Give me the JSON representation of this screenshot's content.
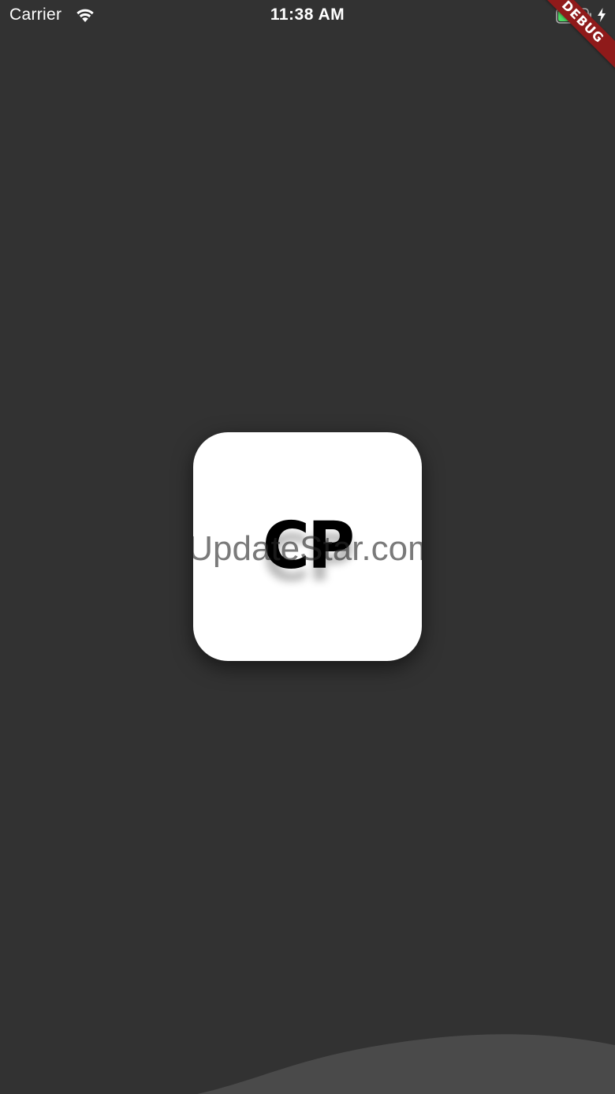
{
  "status_bar": {
    "carrier": "Carrier",
    "time": "11:38 AM",
    "battery_level": 0.6,
    "battery_color": "#4cd964",
    "charging": true,
    "icons": [
      "wifi-icon",
      "battery-icon",
      "charging-bolt-icon"
    ]
  },
  "debug_banner": {
    "label": "DEBUG",
    "color": "#8f1a1a"
  },
  "logo": {
    "text": "CP",
    "background": "#ffffff"
  },
  "watermark": {
    "text": "UpdateStar.com"
  },
  "theme": {
    "background": "#323232",
    "wave_color": "#4a4a4a"
  }
}
